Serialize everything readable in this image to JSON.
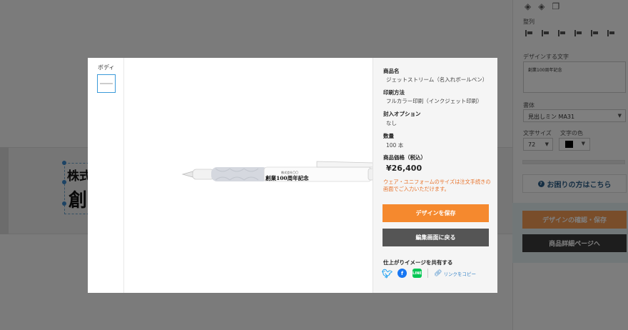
{
  "background": {
    "text_line1": "株式",
    "text_line2": "創",
    "panel": {
      "section_align": "整列",
      "section_text": "デザインする文字",
      "text_value": "創業100周年記念",
      "section_font": "書体",
      "font_value": "見出しミン MA31",
      "section_size": "文字サイズ",
      "size_value": "72",
      "section_color": "文字の色",
      "help_button": "お困りの方はこちら",
      "confirm_button": "デザインの確認・保存",
      "detail_button": "商品詳細ページへ"
    }
  },
  "modal": {
    "thumb_label": "ボディ",
    "pen_text_small": "株式会社〇〇",
    "pen_text_main": "創業100周年記念",
    "info": {
      "name_label": "商品名",
      "name_value": "ジェットストリーム（名入れボールペン）",
      "print_label": "印刷方法",
      "print_value": "フルカラー印刷（インクジェット印刷）",
      "option_label": "封入オプション",
      "option_value": "なし",
      "qty_label": "数量",
      "qty_value": "100 本",
      "price_label": "商品価格（税込）",
      "price_value": "¥26,400",
      "note": "ウェア・ユニフォームのサイズは注文手続きの画面でご入力いただけます。",
      "save_button": "デザインを保存",
      "back_button": "編集画面に戻る",
      "share_label": "仕上がりイメージを共有する",
      "copy_link": "リンクをコピー"
    }
  },
  "colors": {
    "accent_orange": "#f5892e",
    "dark_button": "#555555",
    "note_orange": "#e8722a",
    "selection_blue": "#3a9ad9"
  }
}
